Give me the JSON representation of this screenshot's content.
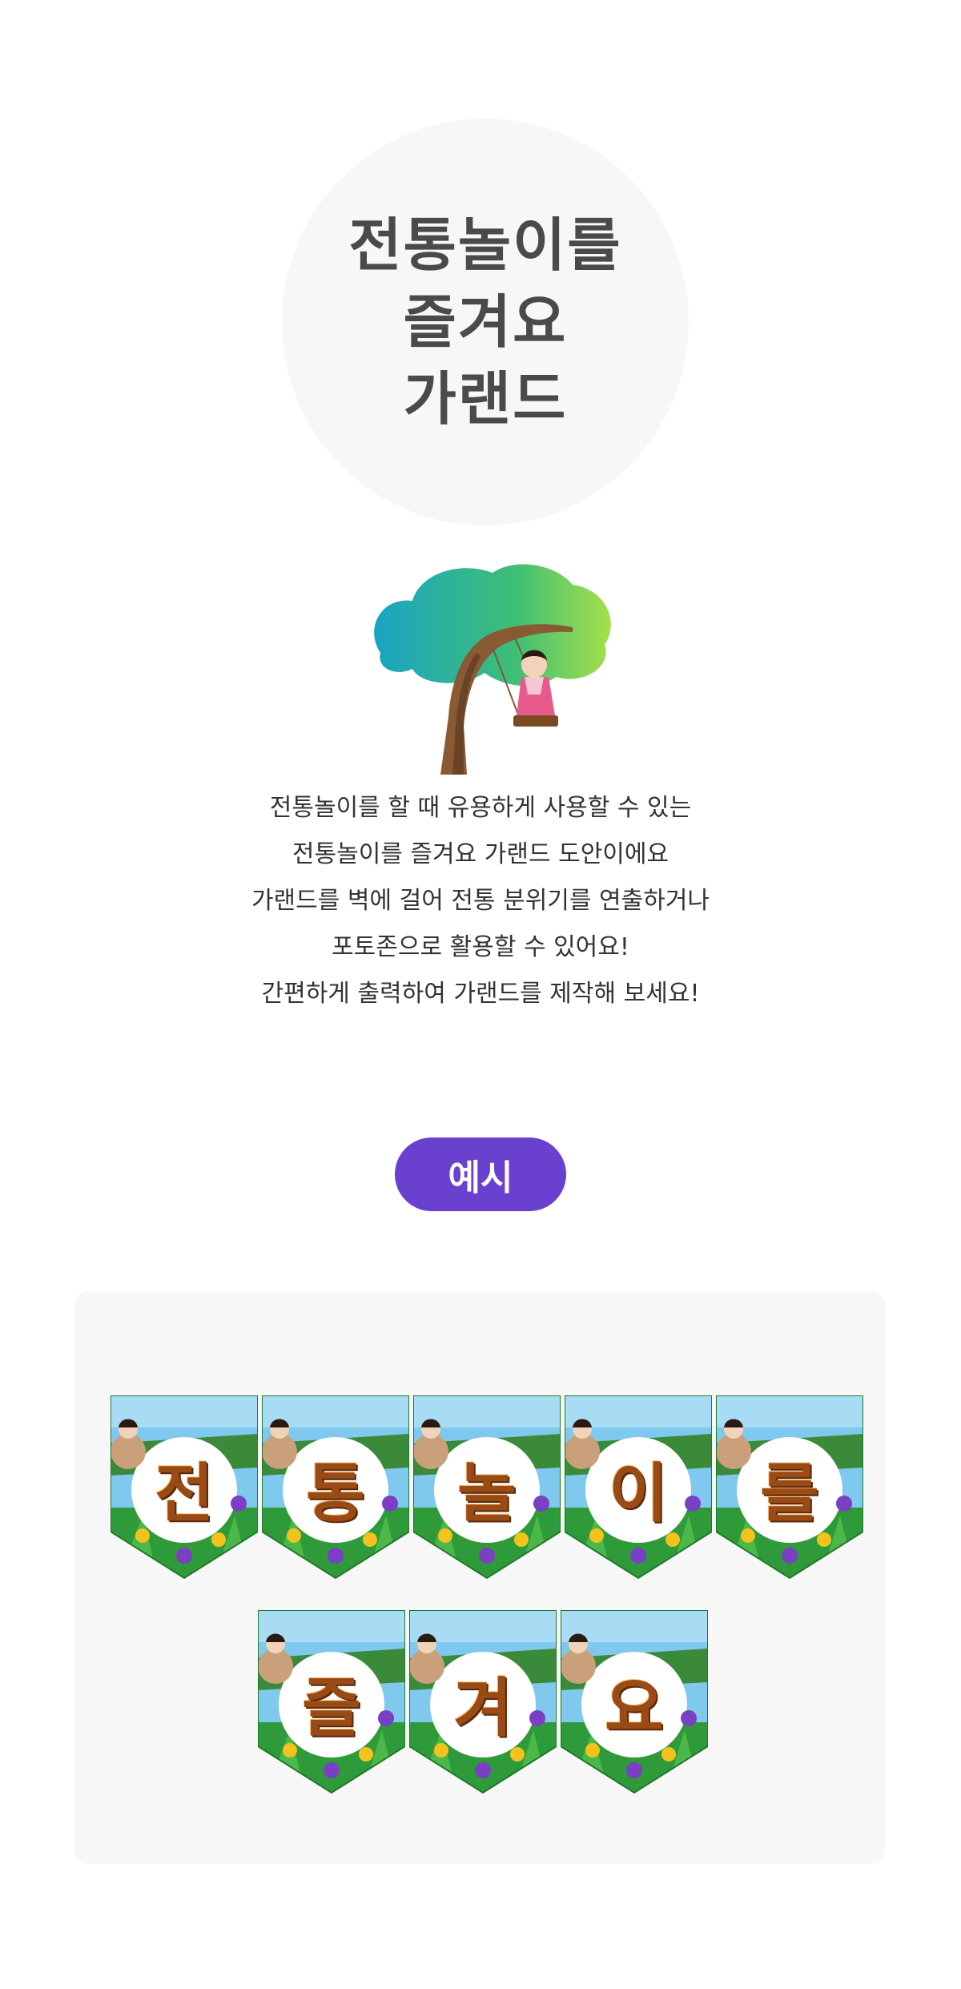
{
  "title": {
    "lines": [
      "전통놀이를",
      "즐겨요",
      "가랜드"
    ]
  },
  "illustration": {
    "name": "tree-swing-illustration"
  },
  "description": {
    "lines": [
      "전통놀이를 할 때 유용하게 사용할 수 있는",
      "전통놀이를 즐겨요 가랜드 도안이에요",
      "가랜드를 벽에 걸어 전통 분위기를 연출하거나",
      "포토존으로 활용할 수 있어요!",
      "간편하게 출력하여 가랜드를 제작해 보세요!"
    ]
  },
  "example": {
    "badge_label": "예시",
    "row1": [
      "전",
      "통",
      "놀",
      "이",
      "를"
    ],
    "row2": [
      "즐",
      "겨",
      "요"
    ]
  },
  "colors": {
    "badge": "#6a40cf",
    "panel": "#f7f7f7",
    "title_circle": "#f7f7f7",
    "letter": "#9a4a14"
  }
}
